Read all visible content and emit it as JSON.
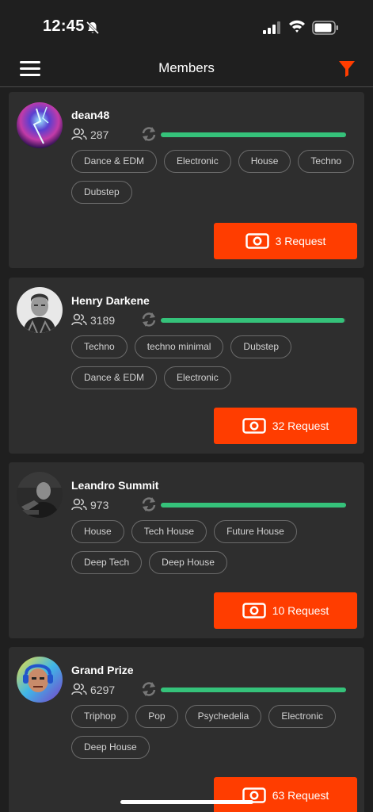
{
  "status_bar": {
    "time": "12:45"
  },
  "header": {
    "title": "Members"
  },
  "colors": {
    "accent": "#ff3d00",
    "progress": "#35c27a",
    "card": "#2e2e2e",
    "background": "#1f1f1f"
  },
  "members": [
    {
      "name": "dean48",
      "followers": "287",
      "progress": 1.0,
      "tags": [
        "Dance & EDM",
        "Electronic",
        "House",
        "Techno",
        "Dubstep"
      ],
      "request_label": "3 Request"
    },
    {
      "name": "Henry Darkene",
      "followers": "3189",
      "progress": 0.99,
      "tags": [
        "Techno",
        "techno minimal",
        "Dubstep",
        "Dance & EDM",
        "Electronic"
      ],
      "request_label": "32 Request"
    },
    {
      "name": "Leandro Summit",
      "followers": "973",
      "progress": 1.0,
      "tags": [
        "House",
        "Tech House",
        "Future House",
        "Deep Tech",
        "Deep House"
      ],
      "request_label": "10 Request"
    },
    {
      "name": "Grand Prize",
      "followers": "6297",
      "progress": 1.0,
      "tags": [
        "Triphop",
        "Pop",
        "Psychedelia",
        "Electronic",
        "Deep House"
      ],
      "request_label": "63 Request"
    }
  ]
}
